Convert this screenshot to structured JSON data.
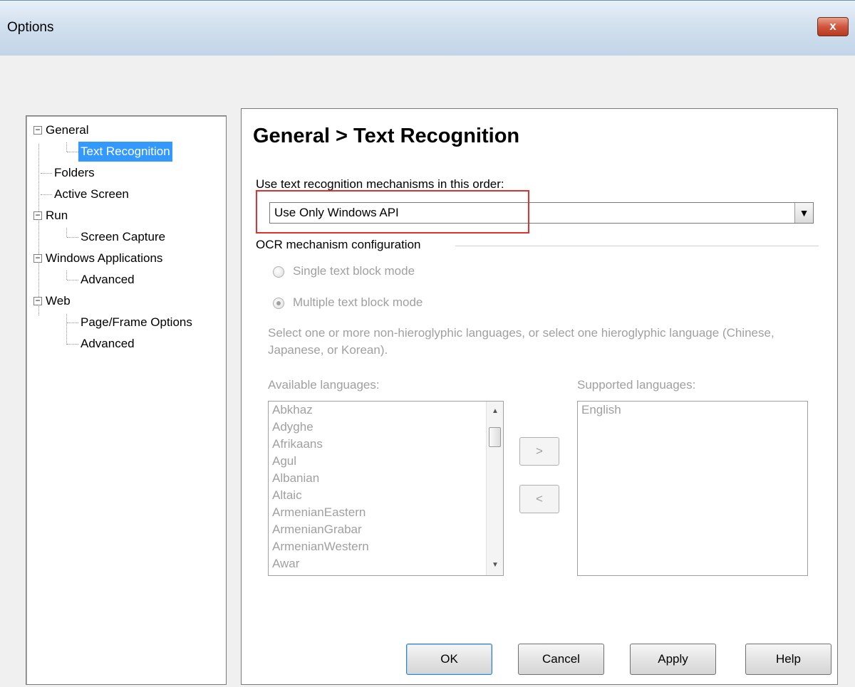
{
  "window": {
    "title": "Options",
    "close_label": "x"
  },
  "tree": {
    "items": [
      {
        "label": "General",
        "expander": "−"
      },
      {
        "label": "Text Recognition"
      },
      {
        "label": "Folders"
      },
      {
        "label": "Active Screen"
      },
      {
        "label": "Run",
        "expander": "−"
      },
      {
        "label": "Screen Capture"
      },
      {
        "label": "Windows Applications",
        "expander": "−"
      },
      {
        "label": "Advanced"
      },
      {
        "label": "Web",
        "expander": "−"
      },
      {
        "label": "Page/Frame Options"
      },
      {
        "label": "Advanced"
      }
    ],
    "selected": "Text Recognition"
  },
  "content": {
    "title": "General > Text Recognition",
    "order_label": "Use text recognition mechanisms in this order:",
    "dropdown_value": "Use Only Windows API",
    "ocr_group_label": "OCR mechanism configuration",
    "radio_single": "Single text block mode",
    "radio_multiple": "Multiple text block mode",
    "radio_selected": "Multiple text block mode",
    "description": "Select one or more non-hieroglyphic languages, or select one hieroglyphic language (Chinese, Japanese, or Korean).",
    "available_label": "Available languages:",
    "supported_label": "Supported languages:",
    "available_languages": [
      "Abkhaz",
      "Adyghe",
      "Afrikaans",
      "Agul",
      "Albanian",
      "Altaic",
      "ArmenianEastern",
      "ArmenianGrabar",
      "ArmenianWestern",
      "Awar"
    ],
    "supported_languages": [
      "English"
    ],
    "add_label": ">",
    "remove_label": "<"
  },
  "buttons": {
    "ok": "OK",
    "cancel": "Cancel",
    "apply": "Apply",
    "help": "Help"
  },
  "colors": {
    "selection": "#3399ff",
    "highlight_box": "#e03030",
    "disabled_text": "#a0a0a0"
  }
}
